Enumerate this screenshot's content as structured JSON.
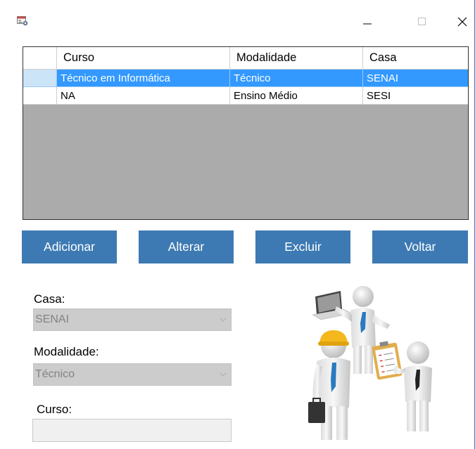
{
  "window": {
    "controls": {
      "minimize": "–",
      "maximize": "☐",
      "close": "✕"
    }
  },
  "grid": {
    "columns": [
      "Curso",
      "Modalidade",
      "Casa"
    ],
    "rows": [
      {
        "curso": "Técnico em Informática",
        "modalidade": "Técnico",
        "casa": "SENAI",
        "selected": true
      },
      {
        "curso": "NA",
        "modalidade": "Ensino Médio",
        "casa": "SESI",
        "selected": false
      }
    ]
  },
  "buttons": {
    "add": "Adicionar",
    "edit": "Alterar",
    "delete": "Excluir",
    "back": "Voltar"
  },
  "form": {
    "casa_label": "Casa:",
    "casa_value": "SENAI",
    "modalidade_label": "Modalidade:",
    "modalidade_value": "Técnico",
    "curso_label": "Curso:",
    "curso_value": ""
  },
  "colors": {
    "button": "#3d7ab3",
    "selection": "#3399ff",
    "grid_background": "#ababab"
  }
}
